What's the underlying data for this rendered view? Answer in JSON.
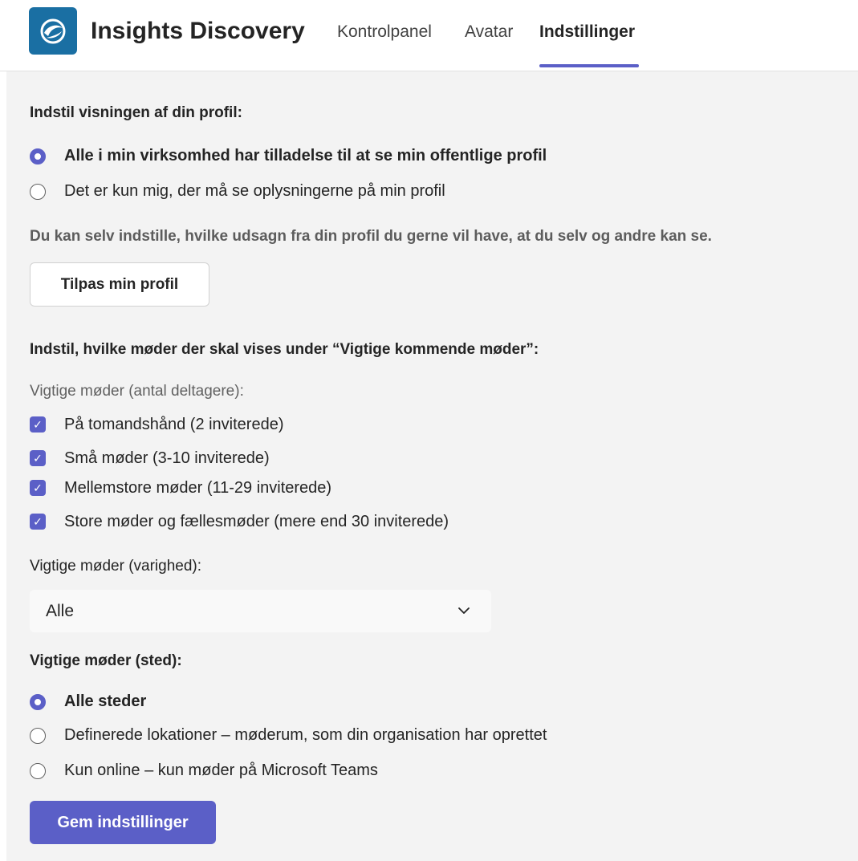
{
  "header": {
    "app_title": "Insights Discovery",
    "tabs": [
      {
        "label": "Kontrolpanel",
        "active": false
      },
      {
        "label": "Avatar",
        "active": false
      },
      {
        "label": "Indstillinger",
        "active": true
      }
    ],
    "accent_color": "#5b5fc7",
    "logo_color": "#1a6fa3"
  },
  "profile": {
    "heading": "Indstil visningen af din profil:",
    "options": [
      {
        "label": "Alle i min virksomhed har tilladelse til at se min offentlige profil",
        "selected": true
      },
      {
        "label": "Det er kun mig, der må se oplysningerne på min profil",
        "selected": false
      }
    ],
    "description": "Du kan selv indstille, hvilke udsagn fra din profil du gerne vil have, at du selv og andre kan se.",
    "customize_button": "Tilpas min profil"
  },
  "meetings": {
    "heading": "Indstil, hvilke møder der skal vises under “Vigtige kommende møder”:",
    "attendees_label": "Vigtige møder (antal deltagere):",
    "attendee_options": [
      {
        "label": "På tomandshånd (2 inviterede)",
        "checked": true
      },
      {
        "label": "Små møder (3-10 inviterede)",
        "checked": true
      },
      {
        "label": "Mellemstore møder (11-29 inviterede)",
        "checked": true
      },
      {
        "label": "Store møder og fællesmøder (mere end 30 inviterede)",
        "checked": true
      }
    ],
    "duration_label": "Vigtige møder (varighed):",
    "duration_value": "Alle",
    "location_label": "Vigtige møder (sted):",
    "location_options": [
      {
        "label": "Alle steder",
        "selected": true
      },
      {
        "label": "Definerede lokationer – møderum, som din organisation har oprettet",
        "selected": false
      },
      {
        "label": "Kun online – kun møder på Microsoft Teams",
        "selected": false
      }
    ],
    "save_button": "Gem indstillinger"
  }
}
